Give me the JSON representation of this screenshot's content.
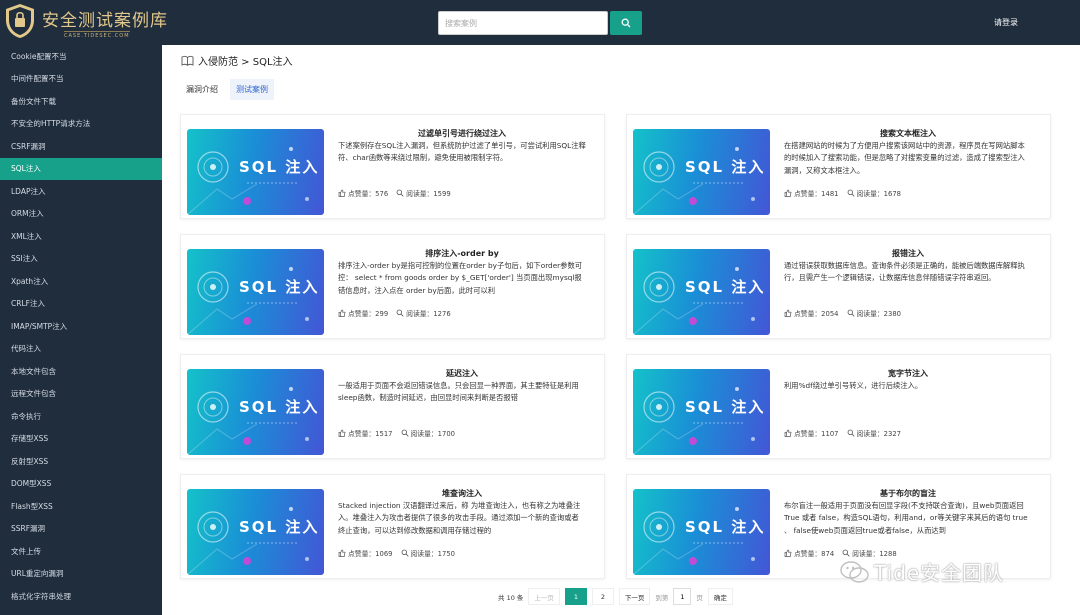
{
  "header": {
    "logo_title": "安全测试案例库",
    "logo_subtitle": "CASE.TIDESEC.COM",
    "search_placeholder": "搜索案例",
    "login_label": "请登录"
  },
  "sidebar": {
    "items": [
      {
        "label": "Cookie配置不当"
      },
      {
        "label": "中间件配置不当"
      },
      {
        "label": "备份文件下载"
      },
      {
        "label": "不安全的HTTP请求方法"
      },
      {
        "label": "CSRF漏洞"
      },
      {
        "label": "SQL注入",
        "active": true
      },
      {
        "label": "LDAP注入"
      },
      {
        "label": "ORM注入"
      },
      {
        "label": "XML注入"
      },
      {
        "label": "SSI注入"
      },
      {
        "label": "Xpath注入"
      },
      {
        "label": "CRLF注入"
      },
      {
        "label": "IMAP/SMTP注入"
      },
      {
        "label": "代码注入"
      },
      {
        "label": "本地文件包含"
      },
      {
        "label": "远程文件包含"
      },
      {
        "label": "命令执行"
      },
      {
        "label": "存储型XSS"
      },
      {
        "label": "反射型XSS"
      },
      {
        "label": "DOM型XSS"
      },
      {
        "label": "Flash型XSS"
      },
      {
        "label": "SSRF漏洞"
      },
      {
        "label": "文件上传"
      },
      {
        "label": "URL重定向漏洞"
      },
      {
        "label": "格式化字符串处理"
      }
    ]
  },
  "breadcrumb": {
    "icon": "book-icon",
    "text": "入侵防范 > SQL注入"
  },
  "tabs": [
    {
      "label": "漏洞介绍",
      "active": false
    },
    {
      "label": "测试案例",
      "active": true
    }
  ],
  "cards": [
    {
      "thumb_text": "SQL 注入",
      "title": "过滤单引号进行绕过注入",
      "desc": "下述案例存在SQL注入漏洞，但系统防护过滤了单引号，可尝试利用SQL注释符、char函数等来绕过限制，避免使用被限制字符。",
      "likes_label": "点赞量：576",
      "reads_label": "阅读量：1599"
    },
    {
      "thumb_text": "SQL 注入",
      "title": "搜索文本框注入",
      "desc": "在搭建网站的时候为了方便用户搜索该网站中的资源，程序员在写网站脚本的时候加入了搜索功能，但是忽略了对搜索变量的过滤，造成了搜索型注入漏洞，又称文本框注入。",
      "likes_label": "点赞量：1481",
      "reads_label": "阅读量：1678"
    },
    {
      "thumb_text": "SQL 注入",
      "title": "排序注入-order by",
      "desc": "排序注入-order by是指可控制的位置在order by子句后，如下order参数可控： select * from goods order by $_GET['order'] 当页面出现mysql报错信息时，注入点在 order by后面，此时可以利",
      "likes_label": "点赞量：299",
      "reads_label": "阅读量：1276"
    },
    {
      "thumb_text": "SQL 注入",
      "title": "报错注入",
      "desc": "通过错误获取数据库信息。查询条件必须是正确的，能被后端数据库解释执行，且需产生一个逻辑错误，让数据库信息伴随错误字符串返回。",
      "likes_label": "点赞量：2054",
      "reads_label": "阅读量：2380"
    },
    {
      "thumb_text": "SQL 注入",
      "title": "延迟注入",
      "desc": "一般适用于页面不会返回错误信息。只会回显一种界面，其主要特征是利用sleep函数，制造时间延迟，由回显时间来判断是否报错",
      "likes_label": "点赞量：1517",
      "reads_label": "阅读量：1700"
    },
    {
      "thumb_text": "SQL 注入",
      "title": "宽字节注入",
      "desc": "利用%df绕过单引号转义，进行后续注入。",
      "likes_label": "点赞量：1107",
      "reads_label": "阅读量：2327"
    },
    {
      "thumb_text": "SQL 注入",
      "title": "堆查询注入",
      "desc": "Stacked injection 汉语翻译过来后，称 为堆查询注入，也有称之为堆叠注入。堆叠注入为攻击者提供了很多的攻击手段。通过添加一个新的查询或者终止查询，可以达到修改数据和调用存储过程的",
      "likes_label": "点赞量：1069",
      "reads_label": "阅读量：1750"
    },
    {
      "thumb_text": "SQL 注入",
      "title": "基于布尔的盲注",
      "desc": "布尔盲注一般适用于页面没有回显字段(不支持联合查询)，且web页面返回True 或者 false，构造SQL语句，利用and，or等关键字来其后的语句 true 、 false使web页面返回true或者false，从而达到",
      "likes_label": "点赞量：874",
      "reads_label": "阅读量：1288"
    }
  ],
  "pagination": {
    "total": "共 10 条",
    "prev": "上一页",
    "pages": [
      "1",
      "2"
    ],
    "current": "1",
    "next": "下一页",
    "goto_label": "到第",
    "goto_value": "1",
    "page_suffix": "页",
    "confirm": "确定"
  },
  "watermark": {
    "text": "Tide安全团队",
    "icon": "wechat-icon"
  },
  "colors": {
    "sidebar_bg": "#1f2d3d",
    "accent": "#17a08a",
    "tab_active": "#2d64c8"
  }
}
